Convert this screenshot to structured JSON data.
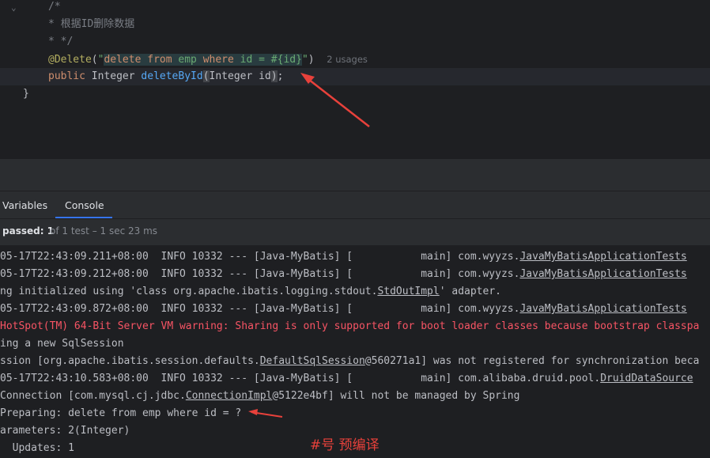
{
  "editor": {
    "lines": {
      "c1": "/*",
      "c2": "* 根据ID删除数据",
      "c3": "* */",
      "annotation": "@Delete",
      "paren_open": "(",
      "quote_open": "\"",
      "sql": "delete from emp where id = #{id}",
      "quote_close": "\"",
      "paren_close": ")",
      "usages": "2 usages",
      "kw_public": "public",
      "type": "Integer",
      "method": "deleteById",
      "params": "(Integer id)",
      "semi": ";",
      "brace": "}"
    }
  },
  "panel": {
    "tabs": [
      {
        "label": "Variables"
      },
      {
        "label": "Console",
        "active": true
      }
    ],
    "status": {
      "passed": "passed: 1",
      "detail": "of 1 test – 1 sec 23 ms"
    }
  },
  "console": {
    "lines": [
      {
        "a": "05-17T22:43:09.211+08:00  INFO 10332 --- [Java-MyBatis] [           main] com.wyyzs.",
        "b": "JavaMyBatisApplicationTests"
      },
      {
        "a": "05-17T22:43:09.212+08:00  INFO 10332 --- [Java-MyBatis] [           main] com.wyyzs.",
        "b": "JavaMyBatisApplicationTests"
      },
      {
        "a": "ng initialized using 'class org.apache.ibatis.logging.stdout.",
        "b": "StdOutImpl",
        "c": "' adapter."
      },
      {
        "a": "05-17T22:43:09.872+08:00  INFO 10332 --- [Java-MyBatis] [           main] com.wyyzs.",
        "b": "JavaMyBatisApplicationTests"
      },
      {
        "a": "HotSpot(TM) 64-Bit Server VM warning: Sharing is only supported for boot loader classes because bootstrap classpa"
      },
      {
        "a": "ing a new SqlSession"
      },
      {
        "a": "ssion [org.apache.ibatis.session.defaults.",
        "b": "DefaultSqlSession",
        "c": "@560271a1] was not registered for synchronization beca"
      },
      {
        "a": "05-17T22:43:10.583+08:00  INFO 10332 --- [Java-MyBatis] [           main] com.alibaba.druid.pool.",
        "b": "DruidDataSource"
      },
      {
        "a": "Connection [com.mysql.cj.jdbc.",
        "b": "ConnectionImpl",
        "c": "@5122e4bf] will not be managed by Spring"
      },
      {
        "a": "Preparing: delete from emp where id = ?"
      },
      {
        "a": "arameters: 2(Integer)"
      },
      {
        "a": "  Updates: 1"
      }
    ]
  },
  "annotation_note": "#号 预编译",
  "colors": {
    "arrow": "#e8413b",
    "accent": "#3574f0"
  }
}
